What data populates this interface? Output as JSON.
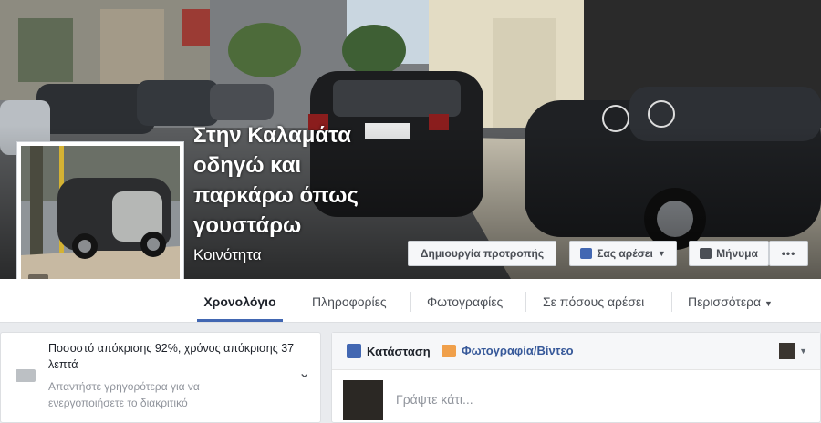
{
  "cover": {
    "page_name": "Στην Καλαμάτα οδηγώ και παρκάρω όπως γουστάρω",
    "category": "Κοινότητα"
  },
  "actions": {
    "promote_label": "Δημιουργία προτροπής",
    "like_label": "Σας αρέσει",
    "message_label": "Μήνυμα",
    "more_label": "•••"
  },
  "nav": {
    "tabs": [
      "Χρονολόγιο",
      "Πληροφορίες",
      "Φωτογραφίες",
      "Σε πόσους αρέσει",
      "Περισσότερα"
    ],
    "active": "Χρονολόγιο"
  },
  "response": {
    "stats": "Ποσοστό απόκρισης 92%, χρόνος απόκρισης 37 λεπτά",
    "hint": "Απαντήστε γρηγορότερα για να ενεργοποιήσετε το διακριτικό"
  },
  "composer": {
    "status_tab": "Κατάσταση",
    "photo_tab": "Φωτογραφία/Βίντεο",
    "placeholder": "Γράψτε κάτι..."
  },
  "colors": {
    "link": "#365899",
    "accent": "#4267b2"
  }
}
